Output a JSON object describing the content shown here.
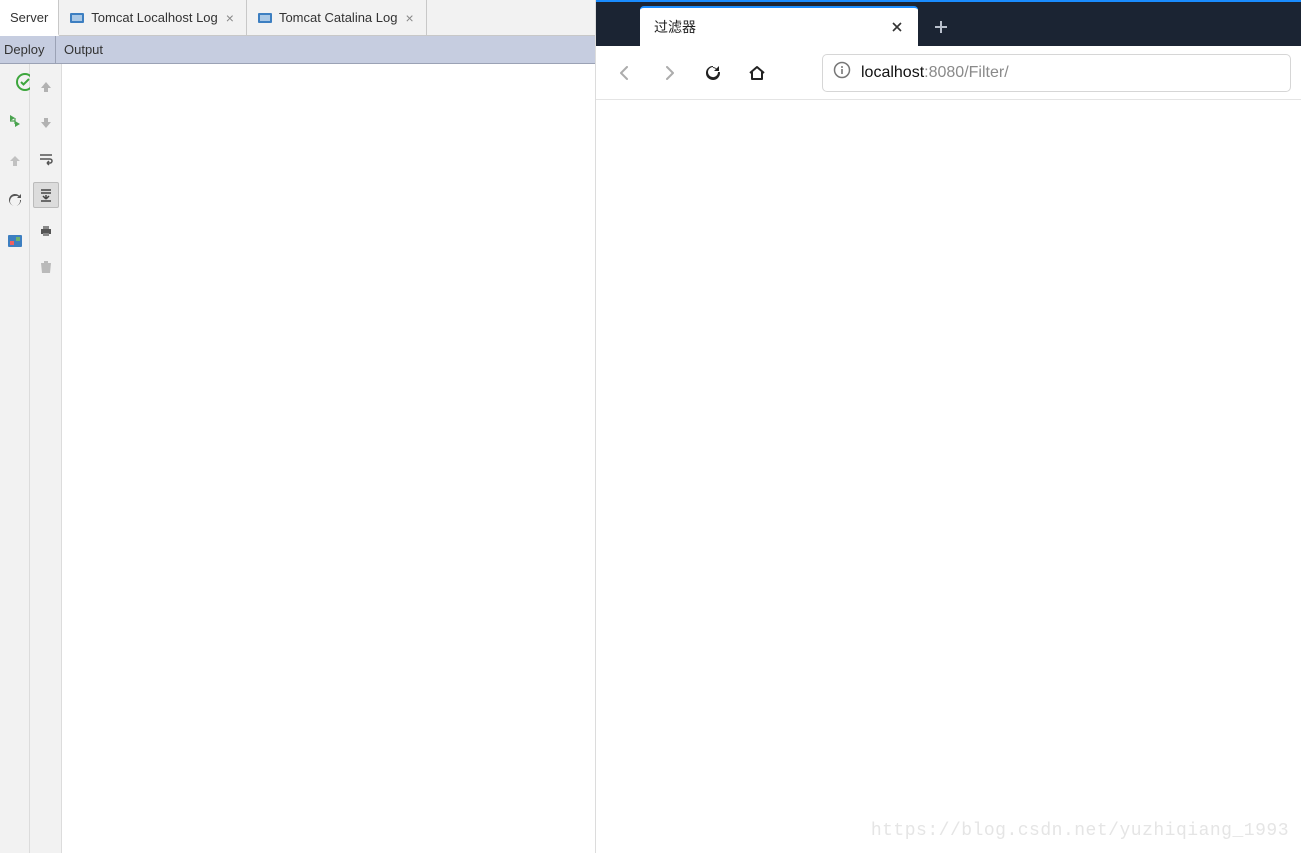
{
  "ide": {
    "tabs": [
      {
        "label": "Server",
        "closable": false
      },
      {
        "label": "Tomcat Localhost Log",
        "closable": true
      },
      {
        "label": "Tomcat Catalina Log",
        "closable": true
      }
    ],
    "subtabs": {
      "deploy": "Deploy",
      "output": "Output"
    },
    "gutter_a": {
      "status_icon": "ok-check-icon",
      "items": [
        "run-icon",
        "undeploy-icon",
        "refresh-icon",
        "artifact-icon"
      ]
    },
    "gutter_b": {
      "items": [
        "arrow-up-icon",
        "arrow-down-icon",
        "soft-wrap-icon",
        "scroll-end-icon",
        "print-icon",
        "trash-icon"
      ]
    }
  },
  "browser": {
    "tab_title": "过滤器",
    "url_host": "localhost",
    "url_rest": ":8080/Filter/"
  },
  "watermark": "https://blog.csdn.net/yuzhiqiang_1993"
}
